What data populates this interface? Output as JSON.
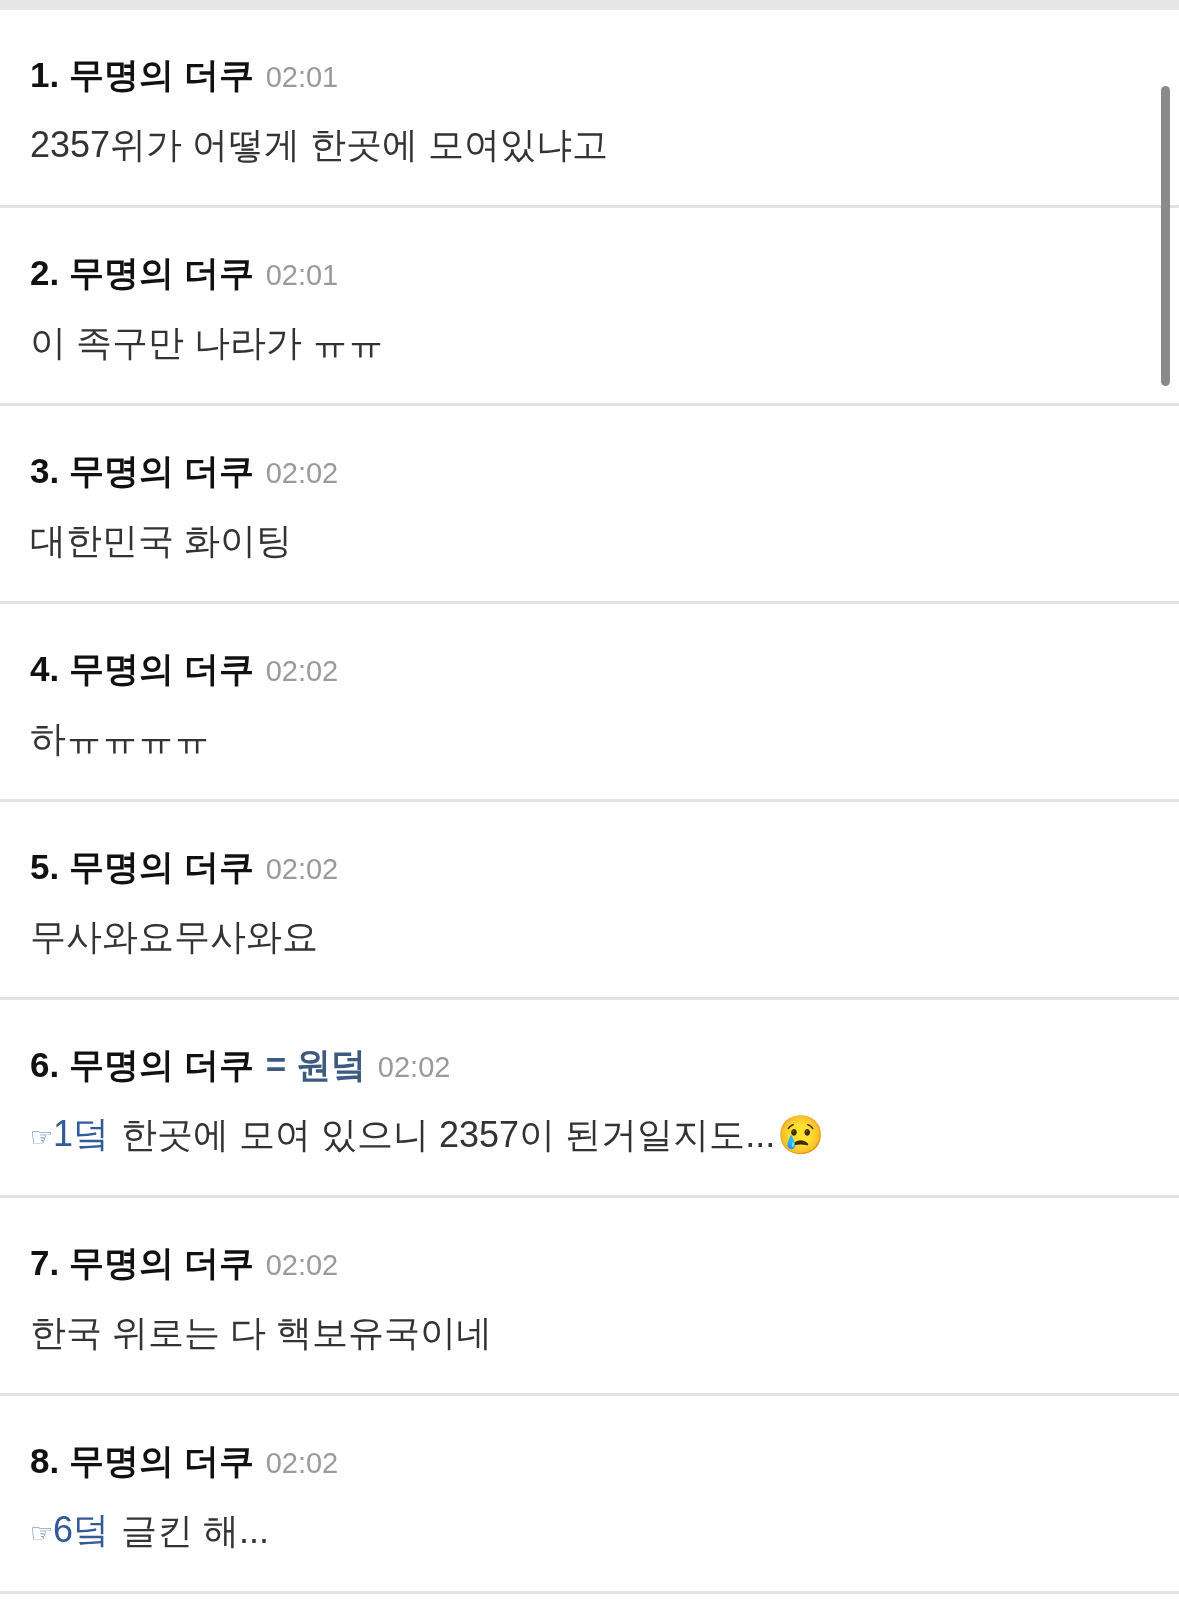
{
  "comments": [
    {
      "number": "1.",
      "author": "무명의 더쿠",
      "time": "02:01",
      "text": "2357위가 어떻게 한곳에 모여있냐고"
    },
    {
      "number": "2.",
      "author": "무명의 더쿠",
      "time": "02:01",
      "text": "이 족구만 나라가 ㅠㅠ"
    },
    {
      "number": "3.",
      "author": "무명의 더쿠",
      "time": "02:02",
      "text": "대한민국 화이팅"
    },
    {
      "number": "4.",
      "author": "무명의 더쿠",
      "time": "02:02",
      "text": "하ㅠㅠㅠㅠ"
    },
    {
      "number": "5.",
      "author": "무명의 더쿠",
      "time": "02:02",
      "text": "무사와요무사와요"
    },
    {
      "number": "6.",
      "author": "무명의 더쿠",
      "alias": "= 원덬",
      "time": "02:02",
      "reply": {
        "marker": "☞",
        "target": "1덬"
      },
      "text": "한곳에 모여 있으니 2357이 된거일지도...",
      "emoji": "😢"
    },
    {
      "number": "7.",
      "author": "무명의 더쿠",
      "time": "02:02",
      "text": "한국 위로는 다 핵보유국이네"
    },
    {
      "number": "8.",
      "author": "무명의 더쿠",
      "time": "02:02",
      "reply": {
        "marker": "☞",
        "target": "6덬"
      },
      "text": "글킨 해..."
    }
  ]
}
